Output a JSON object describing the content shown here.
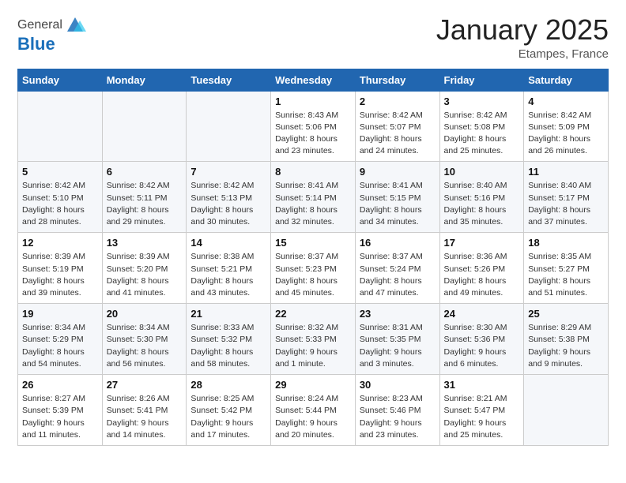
{
  "logo": {
    "general": "General",
    "blue": "Blue"
  },
  "title": "January 2025",
  "subtitle": "Etampes, France",
  "headers": [
    "Sunday",
    "Monday",
    "Tuesday",
    "Wednesday",
    "Thursday",
    "Friday",
    "Saturday"
  ],
  "weeks": [
    [
      {
        "day": "",
        "info": ""
      },
      {
        "day": "",
        "info": ""
      },
      {
        "day": "",
        "info": ""
      },
      {
        "day": "1",
        "info": "Sunrise: 8:43 AM\nSunset: 5:06 PM\nDaylight: 8 hours\nand 23 minutes."
      },
      {
        "day": "2",
        "info": "Sunrise: 8:42 AM\nSunset: 5:07 PM\nDaylight: 8 hours\nand 24 minutes."
      },
      {
        "day": "3",
        "info": "Sunrise: 8:42 AM\nSunset: 5:08 PM\nDaylight: 8 hours\nand 25 minutes."
      },
      {
        "day": "4",
        "info": "Sunrise: 8:42 AM\nSunset: 5:09 PM\nDaylight: 8 hours\nand 26 minutes."
      }
    ],
    [
      {
        "day": "5",
        "info": "Sunrise: 8:42 AM\nSunset: 5:10 PM\nDaylight: 8 hours\nand 28 minutes."
      },
      {
        "day": "6",
        "info": "Sunrise: 8:42 AM\nSunset: 5:11 PM\nDaylight: 8 hours\nand 29 minutes."
      },
      {
        "day": "7",
        "info": "Sunrise: 8:42 AM\nSunset: 5:13 PM\nDaylight: 8 hours\nand 30 minutes."
      },
      {
        "day": "8",
        "info": "Sunrise: 8:41 AM\nSunset: 5:14 PM\nDaylight: 8 hours\nand 32 minutes."
      },
      {
        "day": "9",
        "info": "Sunrise: 8:41 AM\nSunset: 5:15 PM\nDaylight: 8 hours\nand 34 minutes."
      },
      {
        "day": "10",
        "info": "Sunrise: 8:40 AM\nSunset: 5:16 PM\nDaylight: 8 hours\nand 35 minutes."
      },
      {
        "day": "11",
        "info": "Sunrise: 8:40 AM\nSunset: 5:17 PM\nDaylight: 8 hours\nand 37 minutes."
      }
    ],
    [
      {
        "day": "12",
        "info": "Sunrise: 8:39 AM\nSunset: 5:19 PM\nDaylight: 8 hours\nand 39 minutes."
      },
      {
        "day": "13",
        "info": "Sunrise: 8:39 AM\nSunset: 5:20 PM\nDaylight: 8 hours\nand 41 minutes."
      },
      {
        "day": "14",
        "info": "Sunrise: 8:38 AM\nSunset: 5:21 PM\nDaylight: 8 hours\nand 43 minutes."
      },
      {
        "day": "15",
        "info": "Sunrise: 8:37 AM\nSunset: 5:23 PM\nDaylight: 8 hours\nand 45 minutes."
      },
      {
        "day": "16",
        "info": "Sunrise: 8:37 AM\nSunset: 5:24 PM\nDaylight: 8 hours\nand 47 minutes."
      },
      {
        "day": "17",
        "info": "Sunrise: 8:36 AM\nSunset: 5:26 PM\nDaylight: 8 hours\nand 49 minutes."
      },
      {
        "day": "18",
        "info": "Sunrise: 8:35 AM\nSunset: 5:27 PM\nDaylight: 8 hours\nand 51 minutes."
      }
    ],
    [
      {
        "day": "19",
        "info": "Sunrise: 8:34 AM\nSunset: 5:29 PM\nDaylight: 8 hours\nand 54 minutes."
      },
      {
        "day": "20",
        "info": "Sunrise: 8:34 AM\nSunset: 5:30 PM\nDaylight: 8 hours\nand 56 minutes."
      },
      {
        "day": "21",
        "info": "Sunrise: 8:33 AM\nSunset: 5:32 PM\nDaylight: 8 hours\nand 58 minutes."
      },
      {
        "day": "22",
        "info": "Sunrise: 8:32 AM\nSunset: 5:33 PM\nDaylight: 9 hours\nand 1 minute."
      },
      {
        "day": "23",
        "info": "Sunrise: 8:31 AM\nSunset: 5:35 PM\nDaylight: 9 hours\nand 3 minutes."
      },
      {
        "day": "24",
        "info": "Sunrise: 8:30 AM\nSunset: 5:36 PM\nDaylight: 9 hours\nand 6 minutes."
      },
      {
        "day": "25",
        "info": "Sunrise: 8:29 AM\nSunset: 5:38 PM\nDaylight: 9 hours\nand 9 minutes."
      }
    ],
    [
      {
        "day": "26",
        "info": "Sunrise: 8:27 AM\nSunset: 5:39 PM\nDaylight: 9 hours\nand 11 minutes."
      },
      {
        "day": "27",
        "info": "Sunrise: 8:26 AM\nSunset: 5:41 PM\nDaylight: 9 hours\nand 14 minutes."
      },
      {
        "day": "28",
        "info": "Sunrise: 8:25 AM\nSunset: 5:42 PM\nDaylight: 9 hours\nand 17 minutes."
      },
      {
        "day": "29",
        "info": "Sunrise: 8:24 AM\nSunset: 5:44 PM\nDaylight: 9 hours\nand 20 minutes."
      },
      {
        "day": "30",
        "info": "Sunrise: 8:23 AM\nSunset: 5:46 PM\nDaylight: 9 hours\nand 23 minutes."
      },
      {
        "day": "31",
        "info": "Sunrise: 8:21 AM\nSunset: 5:47 PM\nDaylight: 9 hours\nand 25 minutes."
      },
      {
        "day": "",
        "info": ""
      }
    ]
  ]
}
